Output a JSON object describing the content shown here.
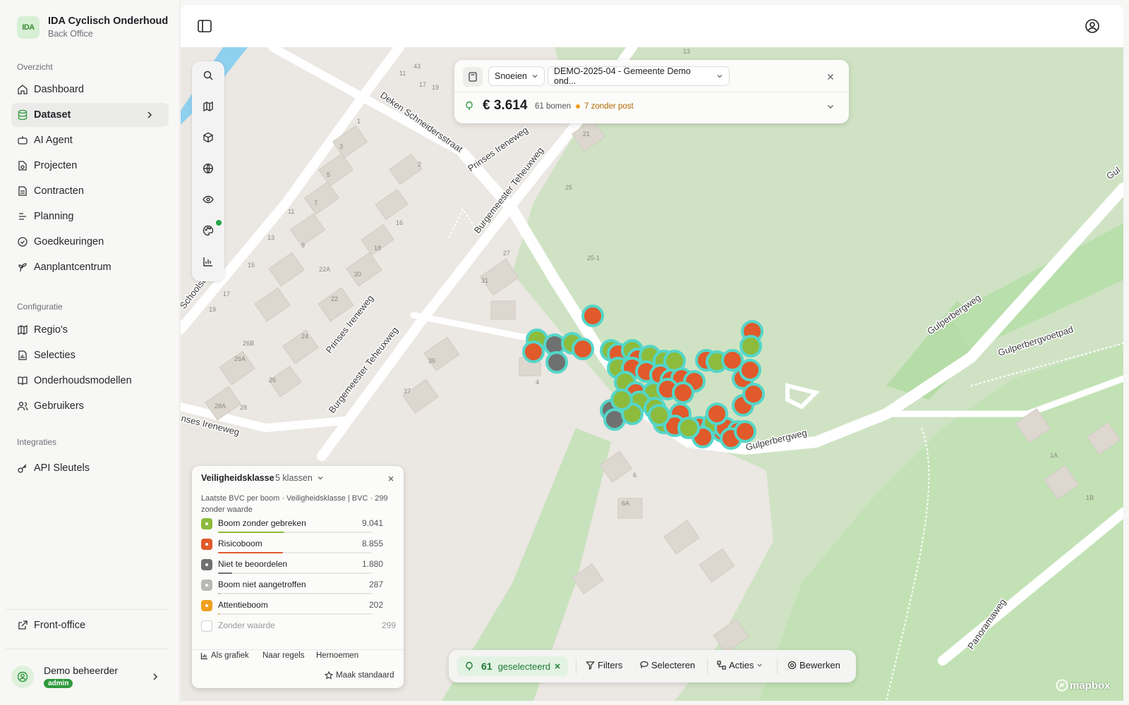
{
  "app": {
    "title": "IDA Cyclisch Onderhoud",
    "subtitle": "Back Office",
    "logo_text": "IDA"
  },
  "sidebar": {
    "sections": [
      {
        "label": "Overzicht",
        "items": [
          {
            "label": "Dashboard",
            "icon": "home-icon"
          },
          {
            "label": "Dataset",
            "icon": "database-icon",
            "active": true
          },
          {
            "label": "AI Agent",
            "icon": "bot-icon"
          },
          {
            "label": "Projecten",
            "icon": "folder-icon"
          },
          {
            "label": "Contracten",
            "icon": "file-icon"
          },
          {
            "label": "Planning",
            "icon": "list-icon"
          },
          {
            "label": "Goedkeuringen",
            "icon": "check-circle-icon"
          },
          {
            "label": "Aanplantcentrum",
            "icon": "sprout-icon"
          }
        ]
      },
      {
        "label": "Configuratie",
        "items": [
          {
            "label": "Regio's",
            "icon": "map-icon"
          },
          {
            "label": "Selecties",
            "icon": "file-chart-icon"
          },
          {
            "label": "Onderhoudsmodellen",
            "icon": "book-icon"
          },
          {
            "label": "Gebruikers",
            "icon": "users-icon"
          }
        ]
      },
      {
        "label": "Integraties",
        "items": [
          {
            "label": "API Sleutels",
            "icon": "key-icon"
          }
        ]
      }
    ],
    "front_office": "Front-office",
    "user": {
      "name": "Demo beheerder",
      "role": "admin"
    }
  },
  "topcard": {
    "activity": "Snoeien",
    "contract": "DEMO-2025-04 - Gemeente Demo ond...",
    "amount": "€ 3.614",
    "count": "61 bomen",
    "warning": "7 zonder post"
  },
  "legend": {
    "title": "Veiligheidsklasse",
    "classes": "5 klassen",
    "description": "Laatste BVC per boom · Veiligheidsklasse | BVC · 299 zonder waarde",
    "rows": [
      {
        "label": "Boom zonder gebreken",
        "value": "9.041",
        "fraction": 0.43,
        "color": "#8dbb3c"
      },
      {
        "label": "Risicoboom",
        "value": "8.855",
        "fraction": 0.42,
        "color": "#e05a2b"
      },
      {
        "label": "Niet te beoordelen",
        "value": "1.880",
        "fraction": 0.09,
        "color": "#6f7170"
      },
      {
        "label": "Boom niet aangetroffen",
        "value": "287",
        "fraction": 0.015,
        "color": "#b8b8b6"
      },
      {
        "label": "Attentieboom",
        "value": "202",
        "fraction": 0.01,
        "color": "#f0a020"
      },
      {
        "label": "Zonder waarde",
        "value": "299",
        "fraction": 0,
        "color": "#ffffff"
      }
    ],
    "actions": {
      "chart": "Als grafiek",
      "rules": "Naar regels",
      "rename": "Hernoemen",
      "default": "Maak standaard"
    }
  },
  "actionbar": {
    "selected_count": "61",
    "selected_label": "geselecteerd",
    "filters": "Filters",
    "select": "Selecteren",
    "actions": "Acties",
    "edit": "Bewerken"
  },
  "map": {
    "streets": [
      "Deken Schneidersstraat",
      "Prinses Ireneweg",
      "Burgemeester Teheuxweg",
      "Schoolstra",
      "Prinses Ireneweg",
      "Burgemeester Teheuxweg",
      "nses Ireneweg",
      "Gulperbergweg",
      "Gulperbergweg",
      "Gulperbergvoetpad",
      "Panoramaweg",
      "Gul"
    ],
    "house_numbers": [
      "43",
      "11",
      "17",
      "19",
      "13",
      "21",
      "1",
      "3",
      "2",
      "5",
      "7",
      "9",
      "25",
      "16",
      "11",
      "13",
      "18",
      "15",
      "22A",
      "20",
      "25-1",
      "27",
      "31",
      "17",
      "22",
      "19",
      "24",
      "26B",
      "26A",
      "26",
      "28A",
      "28",
      "35",
      "37",
      "4",
      "6",
      "6A",
      "1A",
      "1B"
    ],
    "attribution": "mapbox"
  },
  "colors": {
    "risk": "#e05a2b",
    "ok": "#8dbb3c",
    "unrated": "#6f7170",
    "selection": "#54d6c8"
  }
}
